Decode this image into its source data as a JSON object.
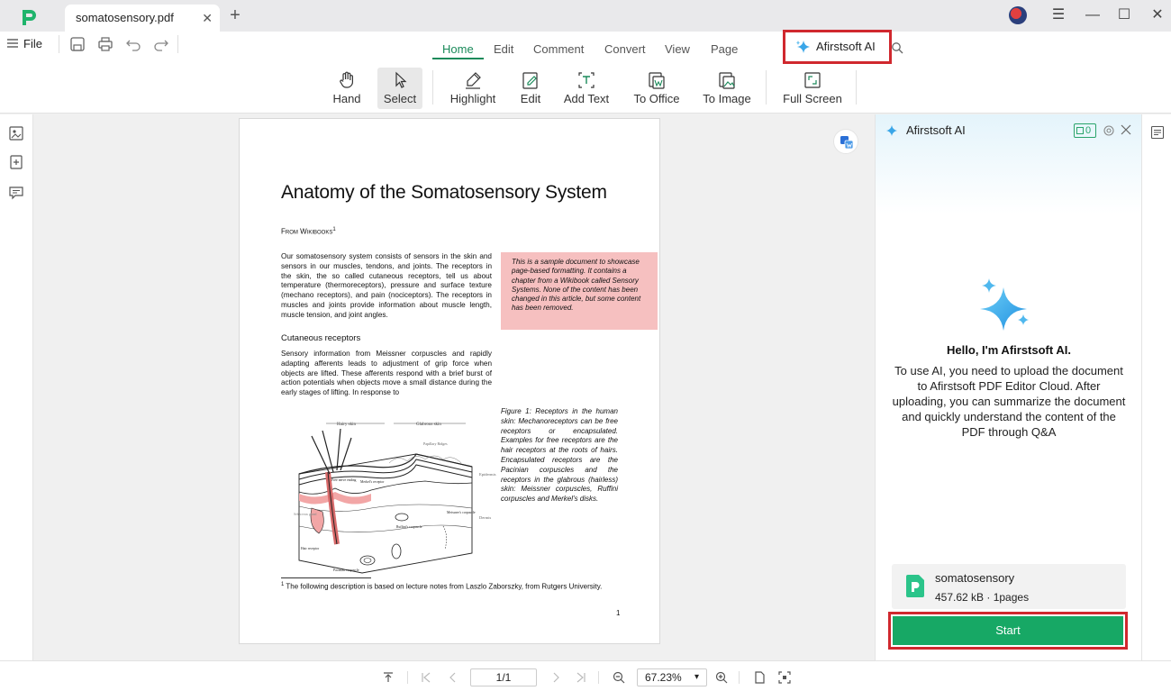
{
  "titlebar": {
    "tab_title": "somatosensory.pdf",
    "tab_close": "✕",
    "new_tab": "+",
    "min": "—",
    "max": "☐",
    "close": "✕",
    "menu": "☰"
  },
  "menubar": {
    "file_label": "File",
    "tabs": [
      {
        "label": "Home",
        "active": true
      },
      {
        "label": "Edit"
      },
      {
        "label": "Comment"
      },
      {
        "label": "Convert"
      },
      {
        "label": "View"
      },
      {
        "label": "Page"
      }
    ],
    "ai_button": "Afirstsoft AI",
    "accent": "#1a8a5a"
  },
  "toolbar": {
    "tools": [
      {
        "label": "Hand",
        "icon": "hand-icon"
      },
      {
        "label": "Select",
        "icon": "cursor-icon",
        "selected": true
      },
      {
        "label": "Highlight",
        "icon": "highlighter-icon"
      },
      {
        "label": "Edit",
        "icon": "edit-icon"
      },
      {
        "label": "Add Text",
        "icon": "add-text-icon"
      },
      {
        "label": "To Office",
        "icon": "to-office-icon"
      },
      {
        "label": "To Image",
        "icon": "to-image-icon"
      },
      {
        "label": "Full Screen",
        "icon": "fullscreen-icon"
      }
    ]
  },
  "document": {
    "title": "Anatomy of the Somatosensory System",
    "from": "From Wikibooks",
    "from_sup": "1",
    "para1": "Our somatosensory system consists of sensors in the skin and sensors in our muscles, tendons, and joints. The receptors in the skin, the so called cutaneous receptors, tell us about temperature (thermoreceptors), pressure and surface texture (mechano receptors), and pain (nociceptors). The receptors in muscles and joints provide information about muscle length, muscle tension, and joint angles.",
    "sidebar_note": "This is a sample document to showcase page-based formatting. It contains a chapter from a Wikibook called Sensory Systems. None of the content has been changed in this article, but some content has been removed.",
    "section_heading": "Cutaneous receptors",
    "para2": "Sensory information from Meissner corpuscles and rapidly adapting afferents leads to adjustment of grip force when objects are lifted. These afferents respond with a brief burst of action potentials when objects move a small distance during the early stages of lifting. In response to",
    "figure_caption": "Figure 1: Receptors in the human skin: Mechanoreceptors can be free receptors or encapsulated. Examples for free receptors are the hair receptors at the roots of hairs. Encapsulated receptors are the Pacinian corpuscles and the receptors in the glabrous (hairless) skin: Meissner corpuscles, Ruffini corpuscles and Merkel's disks.",
    "figure_labels": {
      "hairy": "Hairy skin",
      "glabrous": "Glabrous skin",
      "papillary": "Papillary Ridges",
      "epidermis": "Epidermis",
      "dermis": "Dermis",
      "free_nerve": "Free nerve ending",
      "merkel": "Merkel's receptor",
      "meissner": "Meissner's corpuscle",
      "ruffini": "Ruffini's corpuscle",
      "sebaceous": "Sebaceous gland",
      "hair_receptor": "Hair receptor",
      "pacinian": "Pacinian corpuscle"
    },
    "footnote_sup": "1",
    "footnote": "The following description is based on lecture notes from Laszlo Zaborszky, from Rutgers University.",
    "page_number": "1",
    "highlight_color": "#f6c0c0"
  },
  "ai_panel": {
    "title": "Afirstsoft AI",
    "credits": "0",
    "hello": "Hello, I'm Afirstsoft AI.",
    "description": "To use AI, you need to upload the document to Afirstsoft PDF Editor Cloud. After uploading, you can summarize the document and quickly understand the content of the PDF through Q&A",
    "file_name": "somatosensory",
    "file_meta": "457.62 kB · 1pages",
    "start_label": "Start",
    "start_color": "#17a865",
    "highlight_border": "#d0282e"
  },
  "statusbar": {
    "page": "1/1",
    "zoom": "67.23%",
    "zoom_arrow": "▾"
  }
}
